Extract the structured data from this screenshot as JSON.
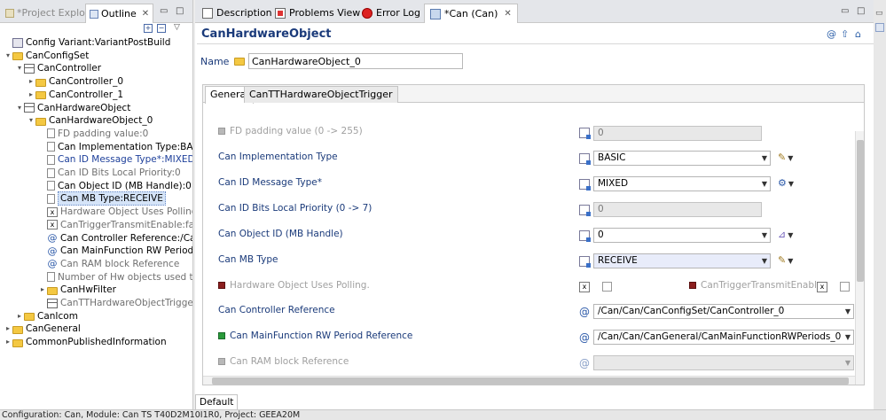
{
  "left_view": {
    "tabs": [
      {
        "label": "*Project Explorer",
        "active": false
      },
      {
        "label": "Outline",
        "active": true
      }
    ],
    "tree": [
      {
        "label": "Config Variant:VariantPostBuild",
        "depth": 0,
        "icon": "cfg",
        "twisty": "",
        "style": ""
      },
      {
        "label": "CanConfigSet",
        "depth": 0,
        "icon": "folder",
        "twisty": "▾",
        "style": ""
      },
      {
        "label": "CanController",
        "depth": 1,
        "icon": "table",
        "twisty": "▾",
        "style": ""
      },
      {
        "label": "CanController_0",
        "depth": 2,
        "icon": "folder",
        "twisty": "▸",
        "style": ""
      },
      {
        "label": "CanController_1",
        "depth": 2,
        "icon": "folder",
        "twisty": "▸",
        "style": ""
      },
      {
        "label": "CanHardwareObject",
        "depth": 1,
        "icon": "table",
        "twisty": "▾",
        "style": ""
      },
      {
        "label": "CanHardwareObject_0",
        "depth": 2,
        "icon": "folder",
        "twisty": "▾",
        "style": ""
      },
      {
        "label": "FD padding value:0",
        "depth": 3,
        "icon": "doc",
        "twisty": "",
        "style": "gray"
      },
      {
        "label": "Can Implementation Type:BASIC",
        "depth": 3,
        "icon": "doc",
        "twisty": "",
        "style": ""
      },
      {
        "label": "Can ID Message Type*:MIXED",
        "depth": 3,
        "icon": "doc",
        "twisty": "",
        "style": "blue"
      },
      {
        "label": "Can ID Bits Local Priority:0",
        "depth": 3,
        "icon": "doc",
        "twisty": "",
        "style": "gray"
      },
      {
        "label": "Can Object ID (MB Handle):0",
        "depth": 3,
        "icon": "doc",
        "twisty": "",
        "style": ""
      },
      {
        "label": "Can MB Type:RECEIVE",
        "depth": 3,
        "icon": "doc",
        "twisty": "",
        "style": "selected"
      },
      {
        "label": "Hardware Object Uses Polling:f",
        "depth": 3,
        "icon": "x",
        "twisty": "",
        "style": "gray"
      },
      {
        "label": "CanTriggerTransmitEnable:false",
        "depth": 3,
        "icon": "x",
        "twisty": "",
        "style": "gray"
      },
      {
        "label": "Can Controller Reference:/Can/C",
        "depth": 3,
        "icon": "at",
        "twisty": "",
        "style": ""
      },
      {
        "label": "Can MainFunction RW Period Re",
        "depth": 3,
        "icon": "at",
        "twisty": "",
        "style": ""
      },
      {
        "label": "Can RAM block Reference",
        "depth": 3,
        "icon": "at",
        "twisty": "",
        "style": "gray"
      },
      {
        "label": "Number of Hw objects used to",
        "depth": 3,
        "icon": "doc",
        "twisty": "",
        "style": "gray"
      },
      {
        "label": "CanHwFilter",
        "depth": 3,
        "icon": "folder",
        "twisty": "▸",
        "style": ""
      },
      {
        "label": "CanTTHardwareObjectTrigger",
        "depth": 3,
        "icon": "table",
        "twisty": "",
        "style": "gray"
      },
      {
        "label": "CanIcom",
        "depth": 1,
        "icon": "folder",
        "twisty": "▸",
        "style": ""
      },
      {
        "label": "CanGeneral",
        "depth": 0,
        "icon": "folder",
        "twisty": "▸",
        "style": ""
      },
      {
        "label": "CommonPublishedInformation",
        "depth": 0,
        "icon": "folder",
        "twisty": "▸",
        "style": ""
      }
    ]
  },
  "editor": {
    "tabs": [
      {
        "label": "Description",
        "active": false
      },
      {
        "label": "Problems View",
        "active": false
      },
      {
        "label": "Error Log",
        "active": false
      },
      {
        "label": "*Can (Can)",
        "active": true
      }
    ],
    "title": "CanHardwareObject",
    "name_label": "Name",
    "name_value": "CanHardwareObject_0",
    "form_tabs": [
      {
        "label": "General",
        "active": true
      },
      {
        "label": "CanTTHardwareObjectTrigger",
        "active": false
      }
    ],
    "fields": {
      "fd_padding": {
        "label": "FD padding value (0 -> 255)",
        "value": "0"
      },
      "impl_type": {
        "label": "Can Implementation Type",
        "value": "BASIC"
      },
      "id_msg_type": {
        "label": "Can ID Message Type*",
        "value": "MIXED"
      },
      "id_bits_prio": {
        "label": "Can ID Bits Local Priority (0 -> 7)",
        "value": "0"
      },
      "object_id": {
        "label": "Can Object ID (MB Handle)",
        "value": "0"
      },
      "mb_type": {
        "label": "Can MB Type",
        "value": "RECEIVE"
      },
      "hw_polling": {
        "label": "Hardware Object Uses Polling."
      },
      "trigger_tx": {
        "label": "CanTriggerTransmitEnable"
      },
      "ctrl_ref": {
        "label": "Can Controller Reference",
        "value": "/Can/Can/CanConfigSet/CanController_0"
      },
      "mainfn_ref": {
        "label": "Can MainFunction RW Period Reference",
        "value": "/Can/Can/CanGeneral/CanMainFunctionRWPeriods_0"
      },
      "ram_ref": {
        "label": "Can RAM block Reference",
        "value": ""
      }
    },
    "bottom_tab": "Default"
  },
  "status_bar": "Configuration: Can, Module: Can TS T40D2M10I1R0, Project: GEEA20M",
  "colors": {
    "accent": "#1a3a7a",
    "selection": "#d5e4f8"
  }
}
